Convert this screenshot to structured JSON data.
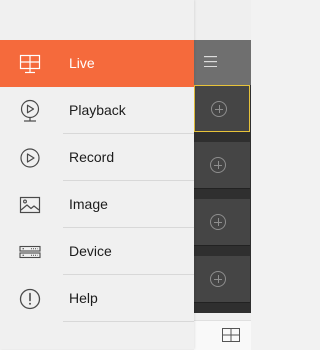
{
  "menu": {
    "items": [
      {
        "label": "Live",
        "icon": "live-monitor-icon",
        "active": true
      },
      {
        "label": "Playback",
        "icon": "playback-icon",
        "active": false
      },
      {
        "label": "Record",
        "icon": "record-icon",
        "active": false
      },
      {
        "label": "Image",
        "icon": "image-icon",
        "active": false
      },
      {
        "label": "Device",
        "icon": "device-icon",
        "active": false
      },
      {
        "label": "Help",
        "icon": "help-icon",
        "active": false
      }
    ]
  },
  "grid": {
    "cells": 4,
    "selected_index": 0
  },
  "colors": {
    "accent": "#f56a3c",
    "topbar": "#6f6f6f",
    "selection": "#e7c33a"
  }
}
